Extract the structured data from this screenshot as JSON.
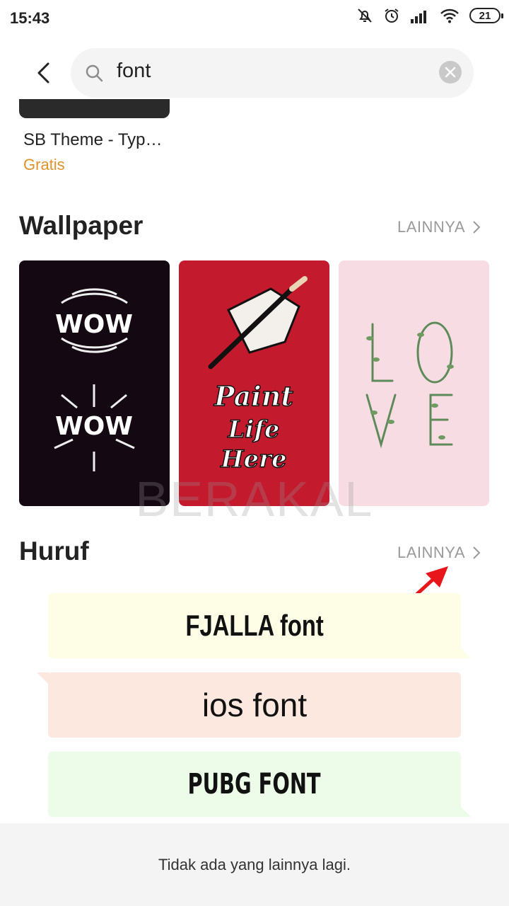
{
  "status_bar": {
    "time": "15:43",
    "battery": "21"
  },
  "search": {
    "query": "font"
  },
  "theme_item": {
    "name": "SB Theme - Typ…",
    "price": "Gratis"
  },
  "wallpaper_section": {
    "title": "Wallpaper",
    "more_label": "LAINNYA"
  },
  "font_section": {
    "title": "Huruf",
    "more_label": "LAINNYA",
    "fonts": [
      {
        "label": "FJALLA font",
        "bg": "#fefee7"
      },
      {
        "label": "ios font",
        "bg": "#fde8e0"
      },
      {
        "label": "PUBG FONT",
        "bg": "#edfce8"
      }
    ]
  },
  "watermark": "BERAKAL",
  "footer": {
    "text": "Tidak ada yang lainnya lagi."
  },
  "colors": {
    "accent_price": "#e0922a",
    "annotation_arrow": "#e8161b"
  }
}
